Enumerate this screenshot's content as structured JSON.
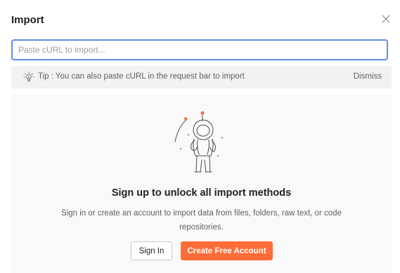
{
  "dialog": {
    "title": "Import"
  },
  "input": {
    "placeholder": "Paste cURL to import...",
    "value": ""
  },
  "tip": {
    "text": "Tip : You can also paste cURL in the request bar to import",
    "dismiss_label": "Dismiss",
    "icon": "lightbulb-icon"
  },
  "panel": {
    "heading": "Sign up to unlock all import methods",
    "description": "Sign in or create an account to import data from files, folders, raw text, or code repositories.",
    "illustration": "astronaut-illustration"
  },
  "buttons": {
    "sign_in_label": "Sign In",
    "create_account_label": "Create Free Account"
  },
  "colors": {
    "accent": "#ff6c37",
    "input_focus_border": "#5b8def",
    "tip_background": "#f2f2f2",
    "panel_background": "#f9f9f9"
  }
}
